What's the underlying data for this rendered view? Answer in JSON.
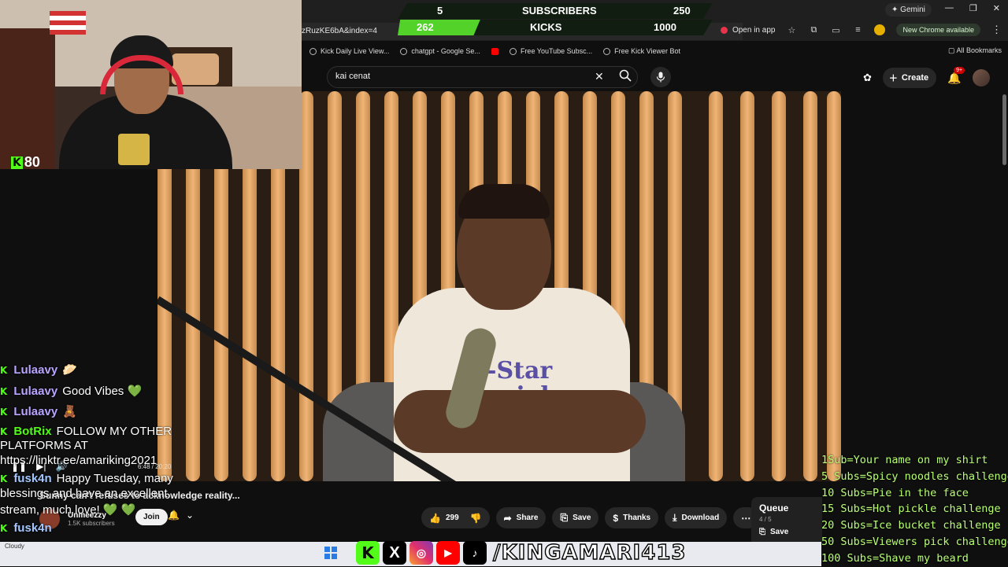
{
  "sub_goal": {
    "sub_current": "5",
    "sub_label": "SUBSCRIBERS",
    "sub_target": "250",
    "kick_current": "262",
    "kick_label": "KICKS",
    "kick_target": "1000",
    "kick_progress": 0.262
  },
  "browser": {
    "url": "zRuzKE6bA&index=4",
    "gemini": "Gemini",
    "open_in_app": "Open in app",
    "new_chrome": "New Chrome available",
    "all_bookmarks": "All Bookmarks",
    "bookmarks": [
      {
        "label": "Kick Daily Live View...",
        "icon": "kick-icon"
      },
      {
        "label": "chatgpt - Google Se...",
        "icon": "google-icon"
      },
      {
        "label": "",
        "icon": "youtube-icon"
      },
      {
        "label": "Free YouTube Subsc...",
        "icon": "globe-icon"
      },
      {
        "label": "Free Kick Viewer Bot",
        "icon": "globe-icon"
      }
    ]
  },
  "youtube": {
    "search_value": "kai cenat",
    "create_label": "Create",
    "notif_count": "9+",
    "video_time": "6:48 / 20:20",
    "title": "Sunny can't refuses to acknowledge reality...",
    "channel_name": "Unmeezzy",
    "channel_subs": "1.5K subscribers",
    "join_label": "Join",
    "likes": "299",
    "share_label": "Share",
    "save_label": "Save",
    "thanks_label": "Thanks",
    "download_label": "Download",
    "queue_title": "Queue",
    "queue_count": "4 / 5",
    "queue_save": "Save",
    "shirt_text": "-Star\necial"
  },
  "webcam": {
    "kick_viewers": "80"
  },
  "chat": [
    {
      "user": "Lulaavy",
      "text": "🥟",
      "color": "purple"
    },
    {
      "user": "Lulaavy",
      "text": "Good Vibes 💚",
      "color": "purple"
    },
    {
      "user": "Lulaavy",
      "text": "🧸",
      "color": "purple"
    },
    {
      "user": "BotRix",
      "text": "FOLLOW MY OTHER",
      "color": "green"
    },
    {
      "user": "",
      "text": "PLATFORMS AT",
      "color": ""
    },
    {
      "user": "",
      "text": "https://linktr.ee/amariking2021",
      "color": ""
    },
    {
      "user": "fusk4n",
      "text": "Happy Tuesday, many",
      "color": "blue"
    },
    {
      "user": "",
      "text": "blessings and have an excellent",
      "color": ""
    },
    {
      "user": "",
      "text": "stream, much love! 💚 💚",
      "color": ""
    },
    {
      "user": "fusk4n",
      "text": "",
      "color": "blue"
    }
  ],
  "goals": [
    "1Sub=Your name on my shirt",
    "5 Subs=Spicy noodles challenge",
    "10 Subs=Pie in the face",
    "15 Subs=Hot pickle challenge",
    "20 Subs=Ice bucket challenge",
    "50 Subs=Viewers pick challenge",
    "100 Subs=Shave my beard"
  ],
  "taskbar": {
    "weather": "Cloudy",
    "handle": "/KINGAMARI413"
  }
}
